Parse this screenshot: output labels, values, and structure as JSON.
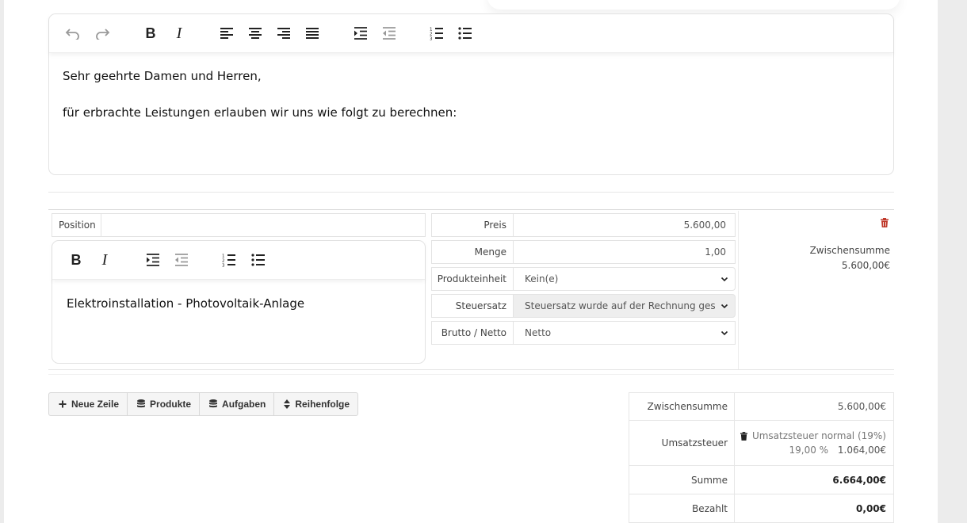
{
  "intro_editor": {
    "line1": "Sehr geehrte Damen und Herren,",
    "line2": "für erbrachte Leistungen erlauben wir uns wie folgt zu berechnen:"
  },
  "position": {
    "label": "Position",
    "value": "",
    "description": "Elektroinstallation - Photovoltaik-Anlage",
    "fields": {
      "preis_label": "Preis",
      "preis_value": "5.600,00",
      "menge_label": "Menge",
      "menge_value": "1,00",
      "einheit_label": "Produkteinheit",
      "einheit_value": "Kein(e)",
      "steuer_label": "Steuersatz",
      "steuer_value": "Steuersatz wurde auf der Rechnung gesetzt",
      "brutto_label": "Brutto / Netto",
      "brutto_value": "Netto"
    },
    "subtotal_label": "Zwischensumme",
    "subtotal_value": "5.600,00€"
  },
  "actions": {
    "new_row": "Neue Zeile",
    "products": "Produkte",
    "tasks": "Aufgaben",
    "order": "Reihenfolge"
  },
  "totals": {
    "subtotal_label": "Zwischensumme",
    "subtotal_value": "5.600,00€",
    "vat_label": "Umsatzsteuer",
    "vat_name": "Umsatzsteuer normal (19%)",
    "vat_rate": "19,00 %",
    "vat_amount": "1.064,00€",
    "sum_label": "Summe",
    "sum_value": "6.664,00€",
    "paid_label": "Bezahlt",
    "paid_value": "0,00€"
  },
  "colors": {
    "accent_delete": "#c0392b"
  }
}
